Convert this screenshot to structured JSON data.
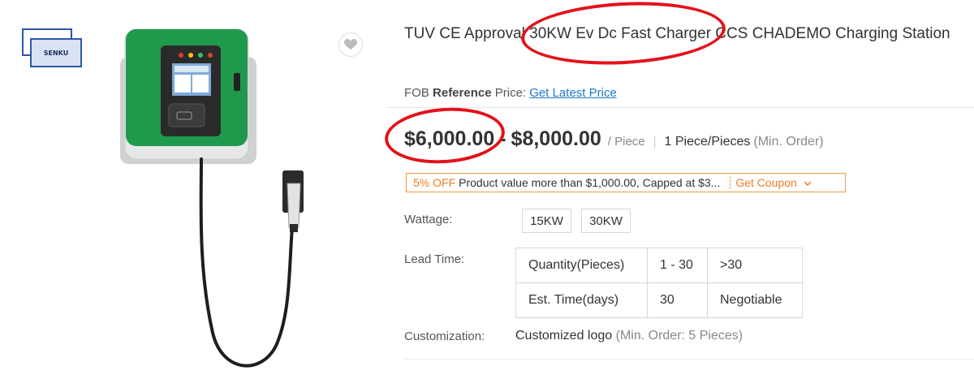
{
  "product": {
    "title": "TUV CE Approval 30KW Ev Dc Fast Charger CCS CHADEMO Charging Station",
    "brand_logo_text": "SENKU",
    "favorite_icon": "heart-icon"
  },
  "fob": {
    "prefix": "FOB ",
    "bold": "Reference",
    "suffix": " Price:",
    "link": "Get Latest Price"
  },
  "price": {
    "min": "$6,000.00",
    "separator": "-",
    "max": "$8,000.00",
    "unit": "/ Piece",
    "divider": "|",
    "moq": "1 Piece/Pieces",
    "moq_note": "(Min. Order)"
  },
  "coupon": {
    "discount": "5% OFF",
    "description": "Product value more than $1,000.00, Capped at $3...",
    "action": "Get Coupon",
    "action_icon": "chevron-down-icon"
  },
  "wattage": {
    "label": "Wattage:",
    "options": [
      "15KW",
      "30KW"
    ]
  },
  "lead_time": {
    "label": "Lead Time:",
    "rows": [
      [
        "Quantity(Pieces)",
        "1 - 30",
        ">30"
      ],
      [
        "Est. Time(days)",
        "30",
        "Negotiable"
      ]
    ]
  },
  "customization": {
    "label": "Customization:",
    "value": "Customized logo",
    "note": "(Min. Order: 5 Pieces)"
  },
  "colors": {
    "charger_green": "#1f9a4c",
    "annotation_red": "#e3111a",
    "coupon_orange": "#f07a22",
    "link_blue": "#1a7ac9"
  }
}
